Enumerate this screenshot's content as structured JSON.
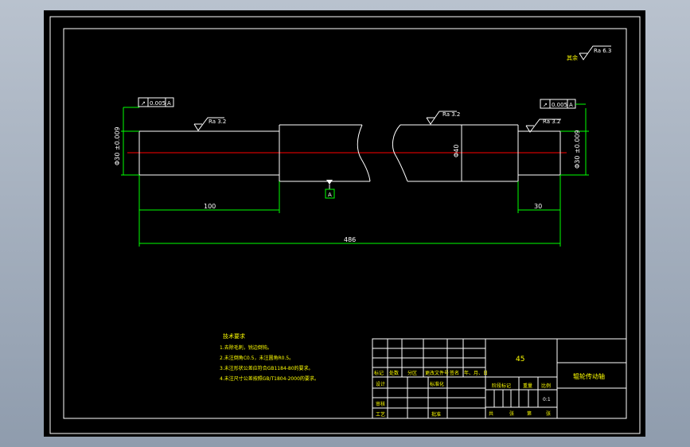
{
  "drawing": {
    "surface_roughness_general": "其余",
    "roughness_values": {
      "general": "Ra 6.3",
      "left_journal": "Ra 3.2",
      "middle": "Ra 3.2",
      "right_journal": "Ra 3.2"
    },
    "tolerance_frames": {
      "left": {
        "symbol": "↗",
        "value": "0.005",
        "datum": "A"
      },
      "right": {
        "symbol": "↗",
        "value": "0.005",
        "datum": "A"
      }
    },
    "datum_label": "A",
    "diameters": {
      "left": "Φ30 ±0.009",
      "middle": "Φ40",
      "right": "Φ30 ±0.009"
    },
    "dimensions": {
      "left_length": "100",
      "right_length": "30",
      "total_length": "486"
    }
  },
  "notes": {
    "title": "技术要求",
    "items": [
      "1.去除毛刺，锐边倒钝。",
      "2.未注倒角C0.5，未注圆角R0.5。",
      "3.未注形状公差应符合GB1184-80的要求。",
      "4.未注尺寸公差按照GB/T1804-2000的要求。"
    ]
  },
  "title_block": {
    "material": "45",
    "part_name": "辊轮传动轴",
    "headers": {
      "mark": "标记",
      "count": "处数",
      "zone": "分区",
      "change_doc": "更改文件号",
      "sign": "签名",
      "date": "年、月、日"
    },
    "design": "设计",
    "standardization": "标准化",
    "review": "审核",
    "process": "工艺",
    "approve": "批准",
    "stage_mark": "阶段标记",
    "weight": "重量",
    "scale_label": "比例",
    "scale_value": "0:1",
    "sheet_total": "共",
    "sheet_label": "张",
    "sheet_no": "第",
    "sheet_label2": "张"
  },
  "colors": {
    "outline": "#ffffff",
    "dimension": "#00ff00",
    "centerline": "#ff0000",
    "text": "#ffff00"
  }
}
